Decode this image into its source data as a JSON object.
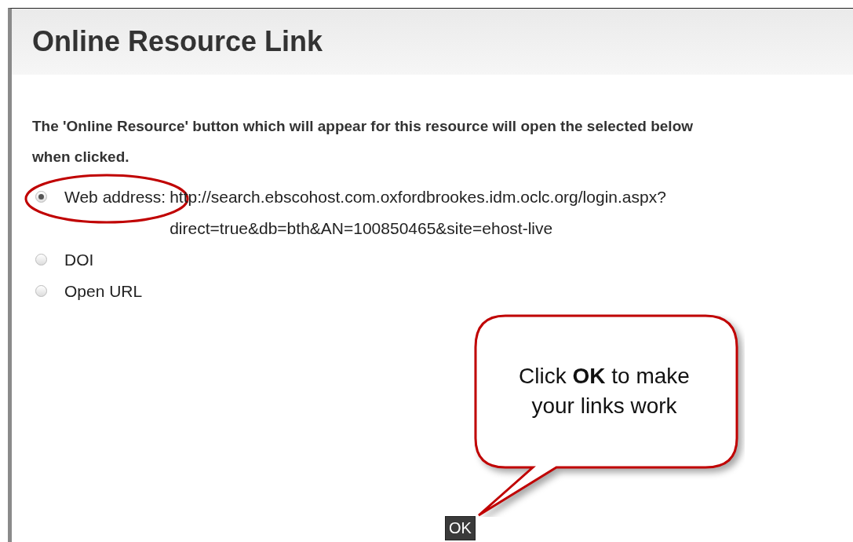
{
  "dialog": {
    "title": "Online Resource Link",
    "description_lines": [
      "The 'Online Resource' button which will appear for this resource will open the selected below",
      "when clicked."
    ],
    "options": [
      {
        "label": "Web address:",
        "value_lines": [
          "http://search.ebscohost.com.oxfordbrookes.idm.oclc.org/login.aspx?",
          "direct=true&db=bth&AN=100850465&site=ehost-live"
        ],
        "selected": true
      },
      {
        "label": "DOI",
        "selected": false
      },
      {
        "label": "Open URL",
        "selected": false
      }
    ],
    "buttons": [
      "OK"
    ]
  },
  "callout": {
    "text": "Click **OK** to make your links work"
  }
}
